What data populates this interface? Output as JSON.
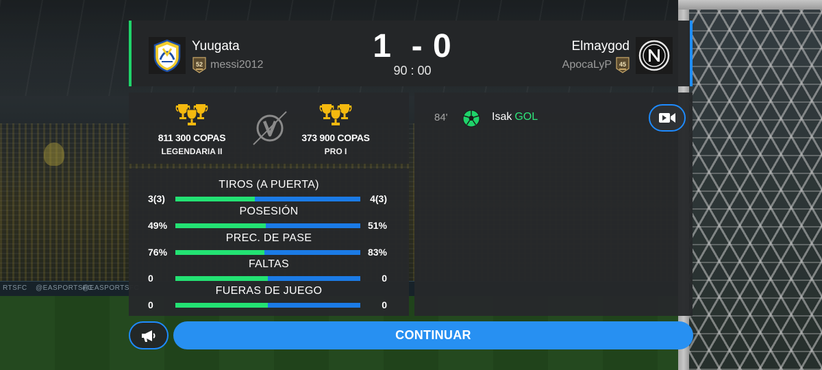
{
  "background": {
    "boards": [
      "RTSFC",
      "@EASPORTSFC",
      "@EASPORTSFC"
    ]
  },
  "scoreboard": {
    "home": {
      "team_name": "Yuugata",
      "username": "messi2012",
      "level": "52",
      "accent_color": "#1fd36a"
    },
    "away": {
      "team_name": "Elmaygod",
      "username": "ApocaLyP",
      "level": "45",
      "accent_color": "#1f8fff"
    },
    "score": "1  - 0",
    "time": "90 : 00"
  },
  "trophies": {
    "home": {
      "copas": "811 300 COPAS",
      "league": "LEGENDARIA II"
    },
    "away": {
      "copas": "373 900 COPAS",
      "league": "PRO I"
    },
    "vs_icon": "v-versus-icon",
    "trophy_color": "#f5b90f"
  },
  "stats": [
    {
      "label": "TIROS (A PUERTA)",
      "home": "3(3)",
      "away": "4(3)",
      "home_share": 0.43
    },
    {
      "label": "POSESIÓN",
      "home": "49%",
      "away": "51%",
      "home_share": 0.49
    },
    {
      "label": "PREC. DE PASE",
      "home": "76%",
      "away": "83%",
      "home_share": 0.48
    },
    {
      "label": "FALTAS",
      "home": "0",
      "away": "0",
      "home_share": 0.5
    },
    {
      "label": "FUERAS DE JUEGO",
      "home": "0",
      "away": "0",
      "home_share": 0.5
    }
  ],
  "events": [
    {
      "minute": "84'",
      "player": "Isak",
      "type": "GOL",
      "icon": "soccer-ball-icon"
    }
  ],
  "buttons": {
    "replay_icon": "video-camera-icon",
    "announce_icon": "megaphone-icon",
    "continue_label": "CONTINUAR"
  },
  "colors": {
    "home_bar": "#23e273",
    "away_bar": "#1b7be6",
    "button_blue": "#2790f2",
    "goal_green": "#2ee57b"
  }
}
